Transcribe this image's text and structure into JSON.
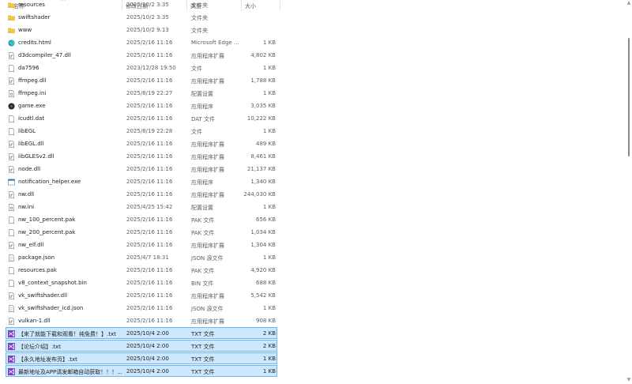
{
  "header": {
    "name": "名称",
    "date": "修改日期",
    "type": "类型",
    "size": "大小"
  },
  "files": [
    {
      "name": "resources",
      "date": "2025/10/2 3:35",
      "type": "文件夹",
      "size": "",
      "icon": "folder-icon",
      "selected": false
    },
    {
      "name": "swiftshader",
      "date": "2025/10/2 3:35",
      "type": "文件夹",
      "size": "",
      "icon": "folder-icon",
      "selected": false
    },
    {
      "name": "www",
      "date": "2025/10/2 9:13",
      "type": "文件夹",
      "size": "",
      "icon": "folder-icon",
      "selected": false
    },
    {
      "name": "credits.html",
      "date": "2025/2/16 11:16",
      "type": "Microsoft Edge ...",
      "size": "1 KB",
      "icon": "edge-icon",
      "selected": false
    },
    {
      "name": "d3dcompiler_47.dll",
      "date": "2025/2/16 11:16",
      "type": "应用程序扩展",
      "size": "4,802 KB",
      "icon": "dll-icon",
      "selected": false
    },
    {
      "name": "da7596",
      "date": "2023/12/28 19:50",
      "type": "文件",
      "size": "1 KB",
      "icon": "file-icon",
      "selected": false
    },
    {
      "name": "ffmpeg.dll",
      "date": "2025/2/16 11:16",
      "type": "应用程序扩展",
      "size": "1,788 KB",
      "icon": "dll-icon",
      "selected": false
    },
    {
      "name": "ffmpeg.ini",
      "date": "2025/8/19 22:27",
      "type": "配置设置",
      "size": "1 KB",
      "icon": "ini-icon",
      "selected": false
    },
    {
      "name": "game.exe",
      "date": "2025/2/16 11:16",
      "type": "应用程序",
      "size": "3,035 KB",
      "icon": "game-exe-icon",
      "selected": false
    },
    {
      "name": "icudtl.dat",
      "date": "2025/2/16 11:16",
      "type": "DAT 文件",
      "size": "10,222 KB",
      "icon": "file-icon",
      "selected": false
    },
    {
      "name": "libEGL",
      "date": "2025/8/19 22:28",
      "type": "文件",
      "size": "1 KB",
      "icon": "file-icon",
      "selected": false
    },
    {
      "name": "libEGL.dll",
      "date": "2025/2/16 11:16",
      "type": "应用程序扩展",
      "size": "489 KB",
      "icon": "dll-icon",
      "selected": false
    },
    {
      "name": "libGLESv2.dll",
      "date": "2025/2/16 11:16",
      "type": "应用程序扩展",
      "size": "8,461 KB",
      "icon": "dll-icon",
      "selected": false
    },
    {
      "name": "node.dll",
      "date": "2025/2/16 11:16",
      "type": "应用程序扩展",
      "size": "21,137 KB",
      "icon": "dll-icon",
      "selected": false
    },
    {
      "name": "notification_helper.exe",
      "date": "2025/2/16 11:16",
      "type": "应用程序",
      "size": "1,340 KB",
      "icon": "exe-icon",
      "selected": false
    },
    {
      "name": "nw.dll",
      "date": "2025/2/16 11:16",
      "type": "应用程序扩展",
      "size": "244,030 KB",
      "icon": "dll-icon",
      "selected": false
    },
    {
      "name": "nw.ini",
      "date": "2025/4/25 15:42",
      "type": "配置设置",
      "size": "1 KB",
      "icon": "ini-icon",
      "selected": false
    },
    {
      "name": "nw_100_percent.pak",
      "date": "2025/2/16 11:16",
      "type": "PAK 文件",
      "size": "656 KB",
      "icon": "file-icon",
      "selected": false
    },
    {
      "name": "nw_200_percent.pak",
      "date": "2025/2/16 11:16",
      "type": "PAK 文件",
      "size": "1,034 KB",
      "icon": "file-icon",
      "selected": false
    },
    {
      "name": "nw_elf.dll",
      "date": "2025/2/16 11:16",
      "type": "应用程序扩展",
      "size": "1,304 KB",
      "icon": "dll-icon",
      "selected": false
    },
    {
      "name": "package.json",
      "date": "2025/4/7 18:31",
      "type": "JSON 源文件",
      "size": "1 KB",
      "icon": "json-icon",
      "selected": false
    },
    {
      "name": "resources.pak",
      "date": "2025/2/16 11:16",
      "type": "PAK 文件",
      "size": "4,920 KB",
      "icon": "file-icon",
      "selected": false
    },
    {
      "name": "v8_context_snapshot.bin",
      "date": "2025/2/16 11:16",
      "type": "BIN 文件",
      "size": "688 KB",
      "icon": "file-icon",
      "selected": false
    },
    {
      "name": "vk_swiftshader.dll",
      "date": "2025/2/16 11:16",
      "type": "应用程序扩展",
      "size": "5,542 KB",
      "icon": "dll-icon",
      "selected": false
    },
    {
      "name": "vk_swiftshader_icd.json",
      "date": "2025/2/16 11:16",
      "type": "JSON 源文件",
      "size": "1 KB",
      "icon": "json-icon",
      "selected": false
    },
    {
      "name": "vulkan-1.dll",
      "date": "2025/2/16 11:16",
      "type": "应用程序扩展",
      "size": "908 KB",
      "icon": "dll-icon",
      "selected": false
    },
    {
      "name": "【来了就能下载和观看！纯免费！】.txt",
      "date": "2025/10/4 2:00",
      "type": "TXT 文件",
      "size": "2 KB",
      "icon": "txt-vs-icon",
      "selected": true
    },
    {
      "name": "【论坛介绍】.txt",
      "date": "2025/10/4 2:00",
      "type": "TXT 文件",
      "size": "2 KB",
      "icon": "txt-vs-icon",
      "selected": true
    },
    {
      "name": "【永久地址发布页】.txt",
      "date": "2025/10/4 2:00",
      "type": "TXT 文件",
      "size": "1 KB",
      "icon": "txt-vs-icon",
      "selected": true
    },
    {
      "name": "最新地址及APP请发邮箱自动获取！！！...",
      "date": "2025/10/4 2:00",
      "type": "TXT 文件",
      "size": "1 KB",
      "icon": "txt-vs-icon",
      "selected": true
    }
  ]
}
